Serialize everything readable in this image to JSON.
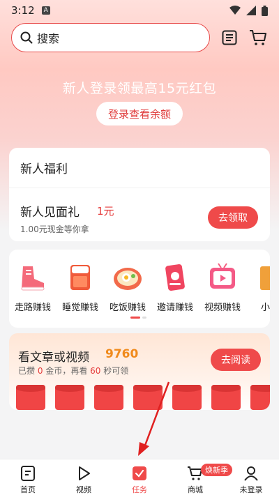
{
  "status_bar": {
    "time": "3:12",
    "notification_letter": "A"
  },
  "search": {
    "placeholder": "搜索"
  },
  "banner": {
    "title": "新人登录领最高15元红包",
    "login_button": "登录查看余额"
  },
  "welfare": {
    "header": "新人福利",
    "gift_title": "新人见面礼",
    "gift_amount": "1元",
    "gift_subtitle": "1.00元现金等你拿",
    "claim_button": "去领取"
  },
  "earn_items": [
    {
      "label": "走路赚钱",
      "icon": "sneaker-icon"
    },
    {
      "label": "睡觉赚钱",
      "icon": "bed-icon"
    },
    {
      "label": "吃饭赚钱",
      "icon": "food-bowl-icon"
    },
    {
      "label": "邀请赚钱",
      "icon": "invite-card-icon"
    },
    {
      "label": "视频赚钱",
      "icon": "tv-video-icon"
    },
    {
      "label": "小说",
      "icon": "book-icon"
    }
  ],
  "article": {
    "title": "看文章或视频",
    "count": "9760",
    "sub_prefix": "已攒",
    "coins": "0",
    "sub_mid": "金币，再看",
    "seconds": "60",
    "sub_suffix": "秒可领",
    "read_button": "去阅读"
  },
  "tabs": [
    {
      "label": "首页",
      "icon": "home-doc-icon",
      "active": false
    },
    {
      "label": "视频",
      "icon": "play-icon",
      "active": false
    },
    {
      "label": "任务",
      "icon": "task-check-icon",
      "active": true
    },
    {
      "label": "商城",
      "icon": "cart-icon",
      "active": false,
      "badge": "焕新季"
    },
    {
      "label": "未登录",
      "icon": "user-icon",
      "active": false
    }
  ],
  "colors": {
    "accent": "#ef4a4a",
    "count_orange": "#f08a1c"
  }
}
